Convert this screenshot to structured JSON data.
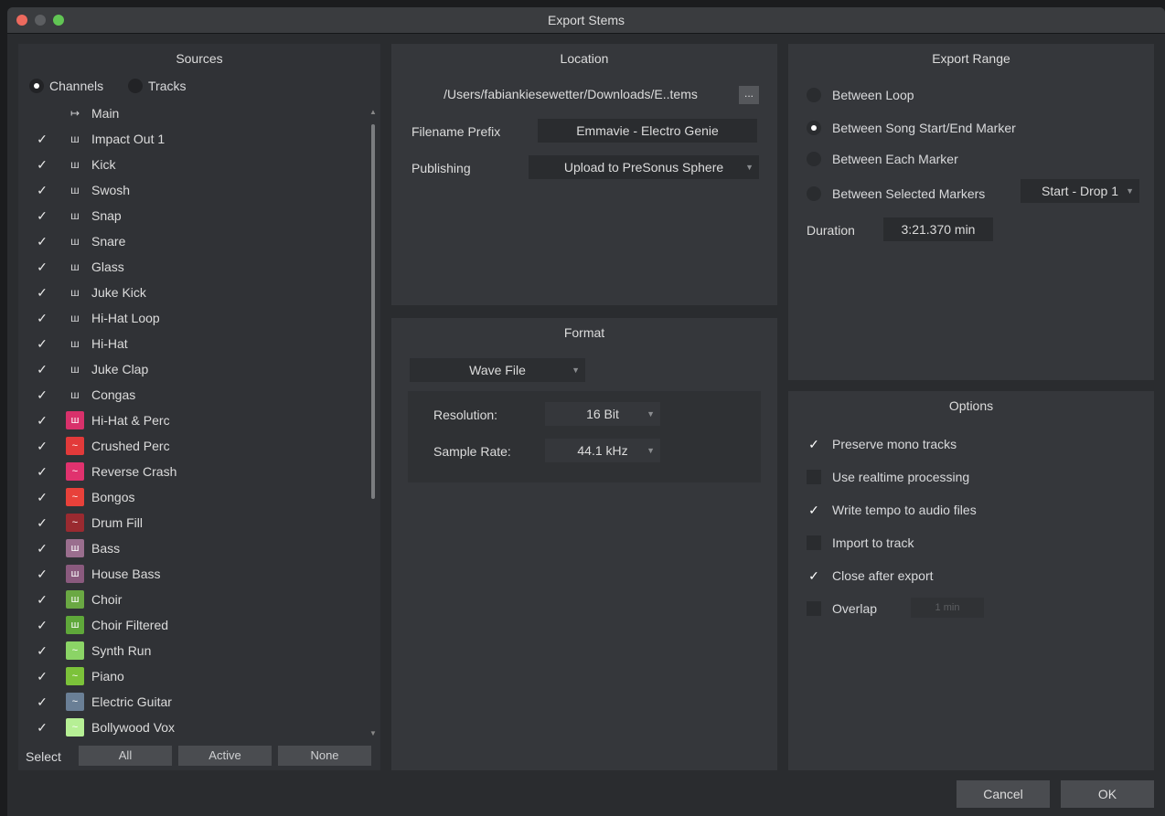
{
  "window": {
    "title": "Export Stems"
  },
  "sources": {
    "title": "Sources",
    "mode_channels": "Channels",
    "mode_tracks": "Tracks",
    "items": [
      {
        "label": "Main",
        "checked": false,
        "icon": "output-arrow-icon",
        "color": ""
      },
      {
        "label": "Impact Out 1",
        "checked": true,
        "icon": "instrument-icon",
        "color": ""
      },
      {
        "label": "Kick",
        "checked": true,
        "icon": "instrument-icon",
        "color": ""
      },
      {
        "label": "Swosh",
        "checked": true,
        "icon": "instrument-icon",
        "color": ""
      },
      {
        "label": "Snap",
        "checked": true,
        "icon": "instrument-icon",
        "color": ""
      },
      {
        "label": "Snare",
        "checked": true,
        "icon": "instrument-icon",
        "color": ""
      },
      {
        "label": "Glass",
        "checked": true,
        "icon": "instrument-icon",
        "color": ""
      },
      {
        "label": "Juke Kick",
        "checked": true,
        "icon": "instrument-icon",
        "color": ""
      },
      {
        "label": "Hi-Hat Loop",
        "checked": true,
        "icon": "instrument-icon",
        "color": ""
      },
      {
        "label": "Hi-Hat",
        "checked": true,
        "icon": "instrument-icon",
        "color": ""
      },
      {
        "label": "Juke Clap",
        "checked": true,
        "icon": "instrument-icon",
        "color": ""
      },
      {
        "label": "Congas",
        "checked": true,
        "icon": "instrument-icon",
        "color": ""
      },
      {
        "label": "Hi-Hat & Perc",
        "checked": true,
        "icon": "instrument-icon",
        "color": "#d8316b"
      },
      {
        "label": "Crushed Perc",
        "checked": true,
        "icon": "audio-icon",
        "color": "#e23a3a"
      },
      {
        "label": "Reverse Crash",
        "checked": true,
        "icon": "audio-icon",
        "color": "#e0326e"
      },
      {
        "label": "Bongos",
        "checked": true,
        "icon": "audio-icon",
        "color": "#e8413a"
      },
      {
        "label": "Drum Fill",
        "checked": true,
        "icon": "audio-icon",
        "color": "#9a2a30"
      },
      {
        "label": "Bass",
        "checked": true,
        "icon": "instrument-icon",
        "color": "#9a6e8e"
      },
      {
        "label": "House Bass",
        "checked": true,
        "icon": "instrument-icon",
        "color": "#8a5a7e"
      },
      {
        "label": "Choir",
        "checked": true,
        "icon": "instrument-icon",
        "color": "#6aa843"
      },
      {
        "label": "Choir Filtered",
        "checked": true,
        "icon": "instrument-icon",
        "color": "#5fa83a"
      },
      {
        "label": "Synth Run",
        "checked": true,
        "icon": "audio-icon",
        "color": "#8bd466"
      },
      {
        "label": "Piano",
        "checked": true,
        "icon": "audio-icon",
        "color": "#7cc23a"
      },
      {
        "label": "Electric Guitar",
        "checked": true,
        "icon": "audio-icon",
        "color": "#6a7f96"
      },
      {
        "label": "Bollywood Vox",
        "checked": true,
        "icon": "audio-icon",
        "color": "#b6ef95"
      }
    ],
    "select_label": "Select",
    "btn_all": "All",
    "btn_active": "Active",
    "btn_none": "None"
  },
  "location": {
    "title": "Location",
    "path": "/Users/fabiankiesewetter/Downloads/E..tems",
    "browse": "...",
    "prefix_label": "Filename Prefix",
    "prefix_value": "Emmavie - Electro Genie",
    "publishing_label": "Publishing",
    "publishing_value": "Upload to PreSonus Sphere"
  },
  "format": {
    "title": "Format",
    "file_type": "Wave File",
    "resolution_label": "Resolution:",
    "resolution_value": "16 Bit",
    "sample_rate_label": "Sample Rate:",
    "sample_rate_value": "44.1 kHz"
  },
  "range": {
    "title": "Export Range",
    "opt_loop": "Between Loop",
    "opt_song": "Between Song Start/End Marker",
    "opt_each": "Between Each Marker",
    "opt_selected": "Between Selected Markers",
    "selected_value": "Start - Drop 1",
    "duration_label": "Duration",
    "duration_value": "3:21.370 min",
    "selected_option": "Between Song Start/End Marker"
  },
  "options": {
    "title": "Options",
    "preserve_mono": "Preserve mono tracks",
    "realtime": "Use realtime processing",
    "write_tempo": "Write tempo to audio files",
    "import_track": "Import to track",
    "close_after": "Close after export",
    "overlap": "Overlap",
    "overlap_value": "1 min"
  },
  "footer": {
    "cancel": "Cancel",
    "ok": "OK"
  }
}
